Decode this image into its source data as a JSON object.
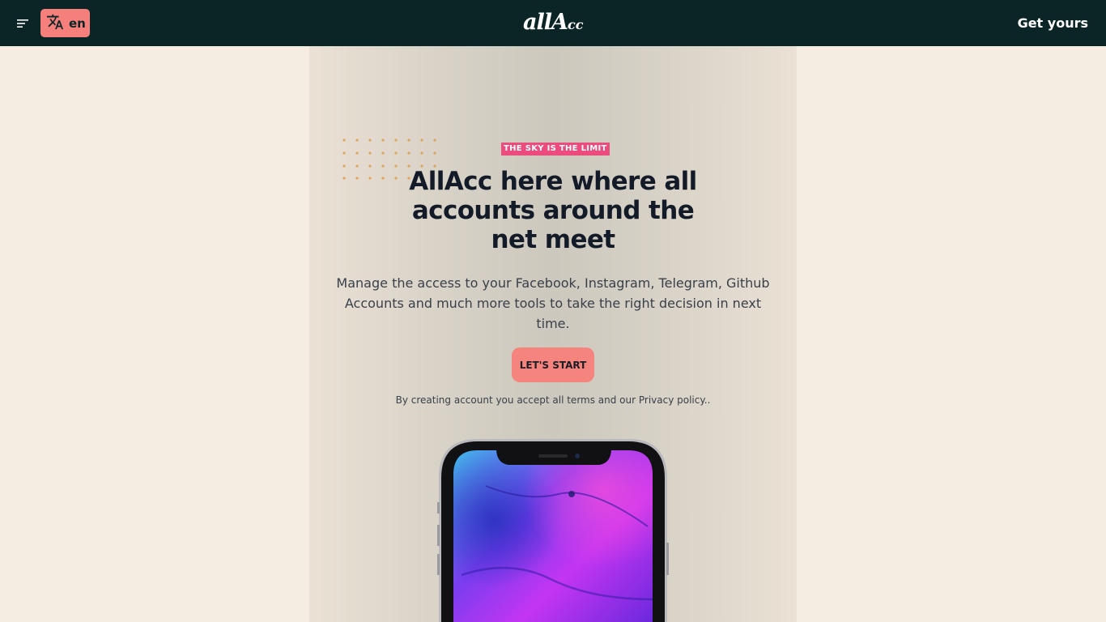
{
  "navbar": {
    "menu_icon": "menu-icon",
    "language": {
      "icon": "translate-icon",
      "label": "en"
    },
    "logo": {
      "main": "allA",
      "sub": "cc"
    },
    "cta_label": "Get yours"
  },
  "hero": {
    "eyebrow": "THE SKY IS THE LIMIT",
    "headline": "AllAcc here where all accounts around the net meet",
    "subtext": "Manage the access to your Facebook, Instagram, Telegram, Github Accounts and much more tools to take the right decision in next time.",
    "start_button": "LET'S START",
    "terms": "By creating account you accept all terms and our Privacy policy.."
  },
  "colors": {
    "navbar": "#0b2526",
    "background": "#f5ece2",
    "accent": "#f4847d",
    "eyebrow": "#ec4c7d",
    "dots": "#e3a35c"
  }
}
